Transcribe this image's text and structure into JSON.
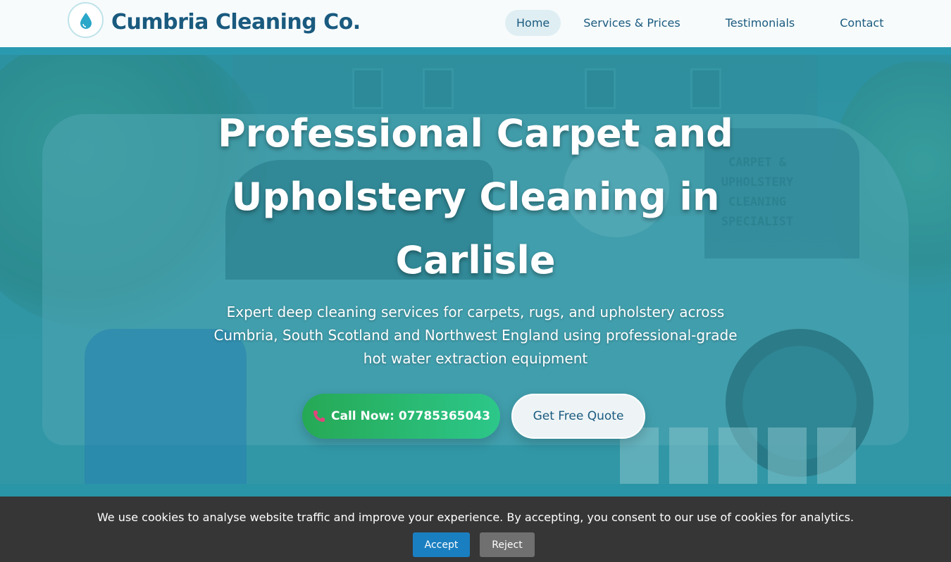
{
  "header": {
    "brand": "Cumbria Cleaning Co.",
    "logo_icon": "water-drop-logo-icon",
    "nav": [
      {
        "label": "Home",
        "active": true
      },
      {
        "label": "Services & Prices",
        "active": false
      },
      {
        "label": "Testimonials",
        "active": false
      },
      {
        "label": "Contact",
        "active": false
      }
    ]
  },
  "hero": {
    "title": "Professional Carpet and Upholstery Cleaning in Carlisle",
    "subtitle": "Expert deep cleaning services for carpets, rugs, and upholstery across Cumbria, South Scotland and Northwest England using professional-grade hot water extraction equipment",
    "call_button": "Call Now: 07785365043",
    "call_icon": "phone-icon",
    "quote_button": "Get Free Quote",
    "van_text": "CARPET & UPHOLSTERY CLEANING SPECIALIST"
  },
  "cookie": {
    "message": "We use cookies to analyse website traffic and improve your experience. By accepting, you consent to our use of cookies for analytics.",
    "accept": "Accept",
    "reject": "Reject"
  },
  "colors": {
    "brand": "#1a5a7f",
    "hero_overlay": "#2a95a6",
    "call_green": "#26a955",
    "accept_blue": "#1a7fc1",
    "reject_gray": "#707070",
    "cookie_bg": "#363636"
  }
}
